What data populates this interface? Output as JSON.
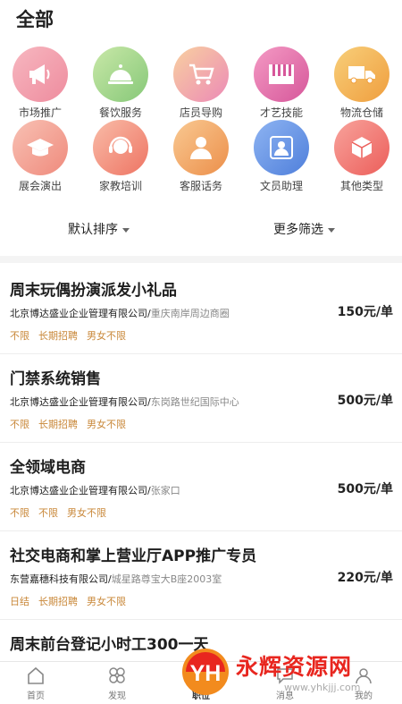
{
  "header": {
    "title": "全部"
  },
  "categories": [
    {
      "label": "市场推广",
      "icon": "megaphone-icon",
      "color": "#ef9aa8"
    },
    {
      "label": "餐饮服务",
      "icon": "cloche-icon",
      "color": "#9ed089"
    },
    {
      "label": "店员导购",
      "icon": "cart-icon",
      "color": "#ee8fb1"
    },
    {
      "label": "才艺技能",
      "icon": "piano-icon",
      "color": "#e46ea6"
    },
    {
      "label": "物流仓储",
      "icon": "truck-icon",
      "color": "#f0b04c"
    },
    {
      "label": "展会演出",
      "icon": "graduation-cap-icon",
      "color": "#f39a8a"
    },
    {
      "label": "家教培训",
      "icon": "headset-icon",
      "color": "#f28a78"
    },
    {
      "label": "客服话务",
      "icon": "person-icon",
      "color": "#f0a35e"
    },
    {
      "label": "文员助理",
      "icon": "user-badge-icon",
      "color": "#5f8ee2"
    },
    {
      "label": "其他类型",
      "icon": "cube-icon",
      "color": "#f06f6a"
    }
  ],
  "filters": {
    "sort_label": "默认排序",
    "more_label": "更多筛选"
  },
  "jobs": [
    {
      "title": "周末玩偶扮演派发小礼品",
      "company": "北京博达盛业企业管理有限公司/",
      "location": "重庆南岸周边商圈",
      "price": "150元/单",
      "tags": [
        "不限",
        "长期招聘",
        "男女不限"
      ]
    },
    {
      "title": "门禁系统销售",
      "company": "北京博达盛业企业管理有限公司/",
      "location": "东岗路世纪国际中心",
      "price": "500元/单",
      "tags": [
        "不限",
        "长期招聘",
        "男女不限"
      ]
    },
    {
      "title": "全领域电商",
      "company": "北京博达盛业企业管理有限公司/",
      "location": "张家口",
      "price": "500元/单",
      "tags": [
        "不限",
        "不限",
        "男女不限"
      ]
    },
    {
      "title": "社交电商和掌上营业厅APP推广专员",
      "company": "东营嘉穗科技有限公司/",
      "location": "城星路尊宝大B座2003室",
      "price": "220元/单",
      "tags": [
        "日结",
        "长期招聘",
        "男女不限"
      ]
    },
    {
      "title": "周末前台登记小时工300一天",
      "company": "",
      "location": "",
      "price": "",
      "tags": []
    }
  ],
  "tabbar": [
    {
      "label": "首页",
      "icon": "home-icon",
      "active": false
    },
    {
      "label": "发现",
      "icon": "discover-icon",
      "active": false
    },
    {
      "label": "职位",
      "icon": "briefcase-icon",
      "active": true
    },
    {
      "label": "消息",
      "icon": "message-icon",
      "active": false
    },
    {
      "label": "我的",
      "icon": "profile-icon",
      "active": false
    }
  ],
  "watermark": {
    "text": "永辉资源网",
    "url": "www.yhkjjj.com",
    "logo_letters": "YH"
  }
}
